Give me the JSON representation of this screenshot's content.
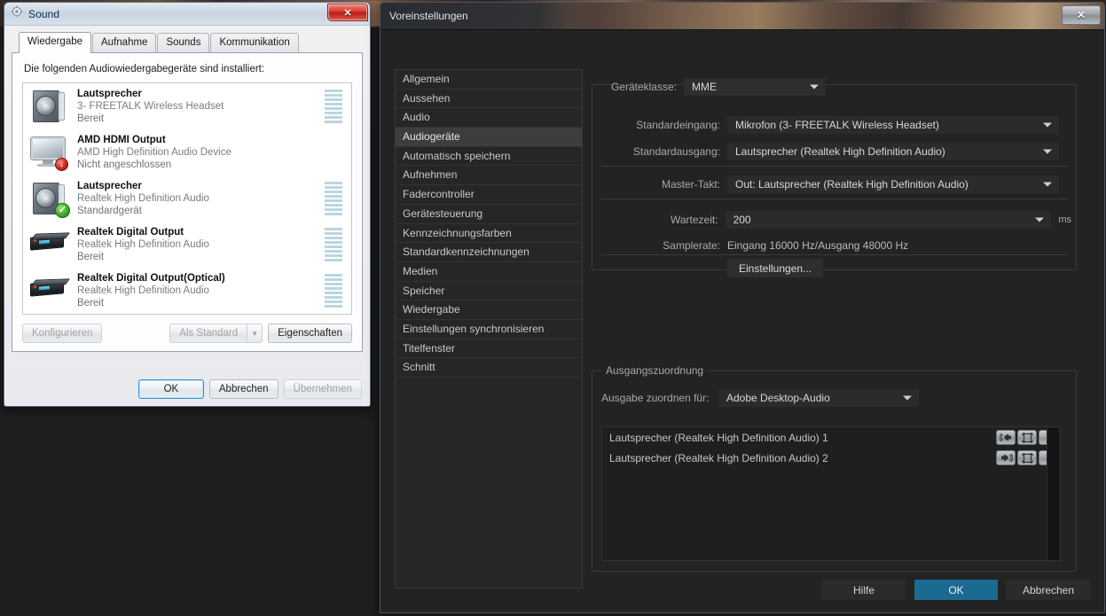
{
  "desktop": {
    "background_color": "#1e1e1e"
  },
  "sound_window": {
    "title": "Sound",
    "close_label": "✕",
    "tabs": [
      {
        "label": "Wiedergabe",
        "active": true
      },
      {
        "label": "Aufnahme",
        "active": false
      },
      {
        "label": "Sounds",
        "active": false
      },
      {
        "label": "Kommunikation",
        "active": false
      }
    ],
    "panel_label": "Die folgenden Audiowiedergabegeräte sind installiert:",
    "devices": [
      {
        "icon": "speaker-icon",
        "badge": "none",
        "name": "Lautsprecher",
        "sub": "3- FREETALK Wireless Headset",
        "state": "Bereit",
        "meter": true
      },
      {
        "icon": "monitor-icon",
        "badge": "down-arrow",
        "name": "AMD HDMI Output",
        "sub": "AMD High Definition Audio Device",
        "state": "Nicht angeschlossen",
        "meter": false
      },
      {
        "icon": "speaker-icon",
        "badge": "green-check",
        "name": "Lautsprecher",
        "sub": "Realtek High Definition Audio",
        "state": "Standardgerät",
        "meter": true
      },
      {
        "icon": "digital-device-icon",
        "badge": "none",
        "name": "Realtek Digital Output",
        "sub": "Realtek High Definition Audio",
        "state": "Bereit",
        "meter": true
      },
      {
        "icon": "digital-device-icon",
        "badge": "none",
        "name": "Realtek Digital Output(Optical)",
        "sub": "Realtek High Definition Audio",
        "state": "Bereit",
        "meter": true
      }
    ],
    "actions": {
      "configure": "Konfigurieren",
      "set_default": "Als Standard",
      "properties": "Eigenschaften"
    },
    "footer": {
      "ok": "OK",
      "cancel": "Abbrechen",
      "apply": "Übernehmen"
    }
  },
  "preferences_window": {
    "title": "Voreinstellungen",
    "close_label": "✕",
    "sidebar": [
      {
        "label": "Allgemein",
        "selected": false
      },
      {
        "label": "Aussehen",
        "selected": false
      },
      {
        "label": "Audio",
        "selected": false
      },
      {
        "label": "Audiogeräte",
        "selected": true
      },
      {
        "label": "Automatisch speichern",
        "selected": false
      },
      {
        "label": "Aufnehmen",
        "selected": false
      },
      {
        "label": "Fadercontroller",
        "selected": false
      },
      {
        "label": "Gerätesteuerung",
        "selected": false
      },
      {
        "label": "Kennzeichnungsfarben",
        "selected": false
      },
      {
        "label": "Standardkennzeichnungen",
        "selected": false
      },
      {
        "label": "Medien",
        "selected": false
      },
      {
        "label": "Speicher",
        "selected": false
      },
      {
        "label": "Wiedergabe",
        "selected": false
      },
      {
        "label": "Einstellungen synchronisieren",
        "selected": false
      },
      {
        "label": "Titelfenster",
        "selected": false
      },
      {
        "label": "Schnitt",
        "selected": false
      }
    ],
    "device_group": {
      "device_class": {
        "label": "Geräteklasse:",
        "value": "MME"
      },
      "default_input": {
        "label": "Standardeingang:",
        "value": "Mikrofon (3- FREETALK Wireless Headset)"
      },
      "default_output": {
        "label": "Standardausgang:",
        "value": "Lautsprecher (Realtek High Definition Audio)"
      },
      "master_clock": {
        "label": "Master-Takt:",
        "value": "Out: Lautsprecher (Realtek High Definition Audio)"
      },
      "latency": {
        "label": "Wartezeit:",
        "value": "200",
        "unit": "ms"
      },
      "samplerate": {
        "label": "Samplerate:",
        "value": "Eingang 16000 Hz/Ausgang 48000 Hz"
      },
      "settings_button": "Einstellungen..."
    },
    "mapping_group": {
      "legend": "Ausgangszuordnung",
      "map_for": {
        "label": "Ausgabe zuordnen für:",
        "value": "Adobe Desktop-Audio"
      },
      "rows": [
        {
          "name": "Lautsprecher (Realtek High Definition Audio) 1",
          "speaker_icon": "speaker-left-icon",
          "pan_icon": "pan-icon",
          "channel": "1"
        },
        {
          "name": "Lautsprecher (Realtek High Definition Audio) 2",
          "speaker_icon": "speaker-right-icon",
          "pan_icon": "pan-icon",
          "channel": "2"
        }
      ]
    },
    "footer": {
      "help": "Hilfe",
      "ok": "OK",
      "cancel": "Abbrechen",
      "accent_color": "#1b6a92"
    }
  }
}
